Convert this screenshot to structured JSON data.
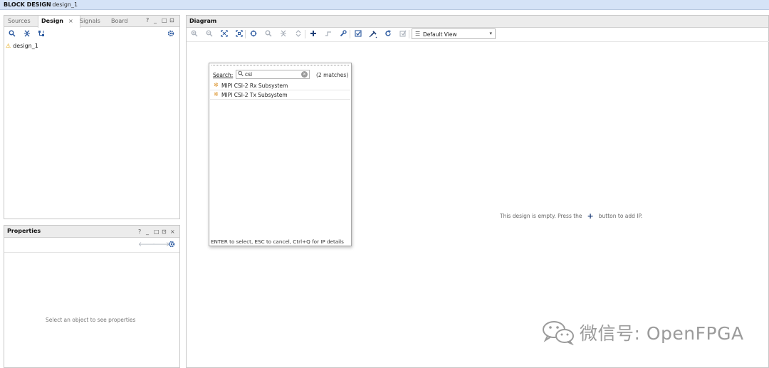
{
  "titlebar": {
    "title_bold": "BLOCK DESIGN",
    "title_rest": "- design_1"
  },
  "left_panel": {
    "tabs": [
      {
        "label": "Sources"
      },
      {
        "label": "Design",
        "close": "×"
      },
      {
        "label": "Signals"
      },
      {
        "label": "Board"
      }
    ],
    "window_controls": [
      "?",
      "_",
      "□",
      "⊡"
    ],
    "toolbar_icons": [
      "search-icon",
      "collapse-all-icon",
      "hierarchy-icon",
      "gear-icon"
    ],
    "tree": [
      {
        "label": "design_1",
        "icon": "warning-icon"
      }
    ]
  },
  "properties": {
    "title": "Properties",
    "window_controls": [
      "?",
      "_",
      "□",
      "⊡",
      "×"
    ],
    "toolbar_icons": [
      "back-arrow-icon",
      "forward-arrow-icon",
      "gear-icon"
    ],
    "empty_text": "Select an object to see properties"
  },
  "diagram": {
    "title": "Diagram",
    "toolbar_icons": [
      "zoom-in-icon",
      "zoom-out-icon",
      "fit-full-icon",
      "fit-selection-icon",
      "auto-fit-icon",
      "search-icon",
      "collapse-icon",
      "expand-icon",
      "add-ip-icon",
      "routing-icon",
      "wrench-icon",
      "validate-icon",
      "pin-icon",
      "refresh-icon",
      "regenerate-icon"
    ],
    "view_select": {
      "value": "Default View"
    },
    "empty_text_before": "This design is empty. Press the",
    "empty_text_after": "button to add IP."
  },
  "ip_search_popup": {
    "search_label": "Search:",
    "search_value": "csi",
    "matches": "(2 matches)",
    "results": [
      {
        "label": "MIPI CSI-2 Rx Subsystem"
      },
      {
        "label": "MIPI CSI-2 Tx Subsystem"
      }
    ],
    "hint": "ENTER to select, ESC to cancel, Ctrl+Q for IP details"
  },
  "watermark": {
    "text": "微信号: OpenFPGA"
  },
  "colors": {
    "accent": "#2c5aa0",
    "titlebar_bg": "#d5e3f7",
    "warning": "#e0a000",
    "ip_icon": "#d88a1a"
  }
}
